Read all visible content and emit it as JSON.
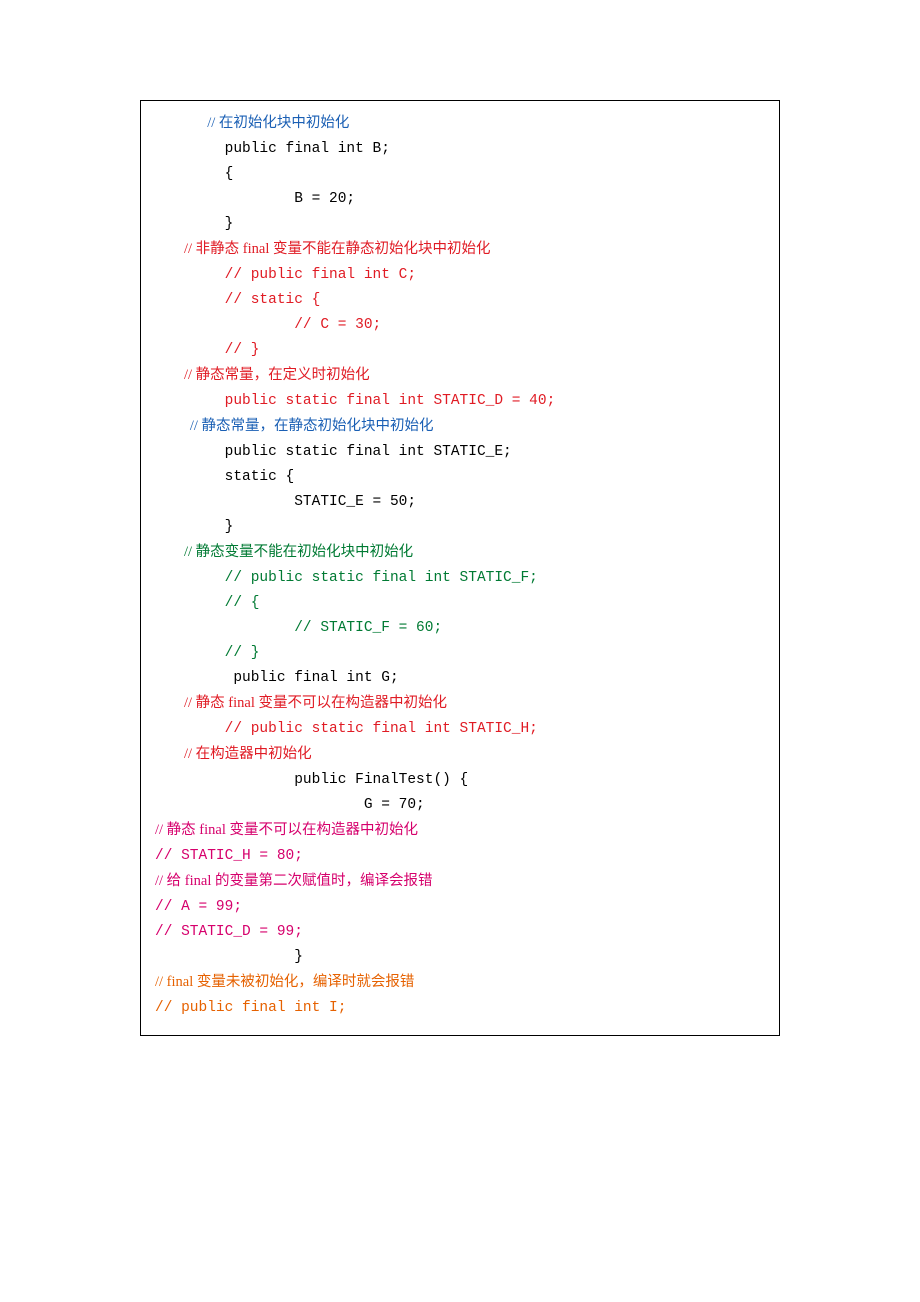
{
  "code": {
    "l01": "// 在初始化块中初始化",
    "l02": "        public final int B;",
    "l03": "        {",
    "l04": "                B = 20;",
    "l05": "        }",
    "l06": "",
    "l07": "        // 非静态 final 变量不能在静态初始化块中初始化",
    "l08": "        // public final int C;",
    "l09": "        // static {",
    "l10": "                // C = 30;",
    "l11": "        // }",
    "l12": "",
    "l13": "        // 静态常量，在定义时初始化",
    "l14": "        public static final int STATIC_D = 40;",
    "l15": "",
    "l16": "// 静态常量，在静态初始化块中初始化",
    "l17": "        public static final int STATIC_E;",
    "l18": "        static {",
    "l19": "                STATIC_E = 50;",
    "l20": "        }",
    "l21": "",
    "l22": "        // 静态变量不能在初始化块中初始化",
    "l23": "        // public static final int STATIC_F;",
    "l24": "        // {",
    "l25": "                // STATIC_F = 60;",
    "l26": "        // }",
    "l27": "",
    "l28": "         public final int G;",
    "l29": "",
    "l30": "        // 静态 final 变量不可以在构造器中初始化",
    "l31": "        // public static final int STATIC_H;",
    "l32": "        // 在构造器中初始化",
    "l33": "                public FinalTest() {",
    "l34": "                        G = 70;",
    "l35": "// 静态 final 变量不可以在构造器中初始化",
    "l36": "// STATIC_H = 80;",
    "l37": "",
    "l38": "// 给 final 的变量第二次赋值时，编译会报错",
    "l39": "// A = 99;",
    "l40": "// STATIC_D = 99;",
    "l41": "                }",
    "l42": "// final 变量未被初始化，编译时就会报错",
    "l43": "// public final int I;"
  }
}
